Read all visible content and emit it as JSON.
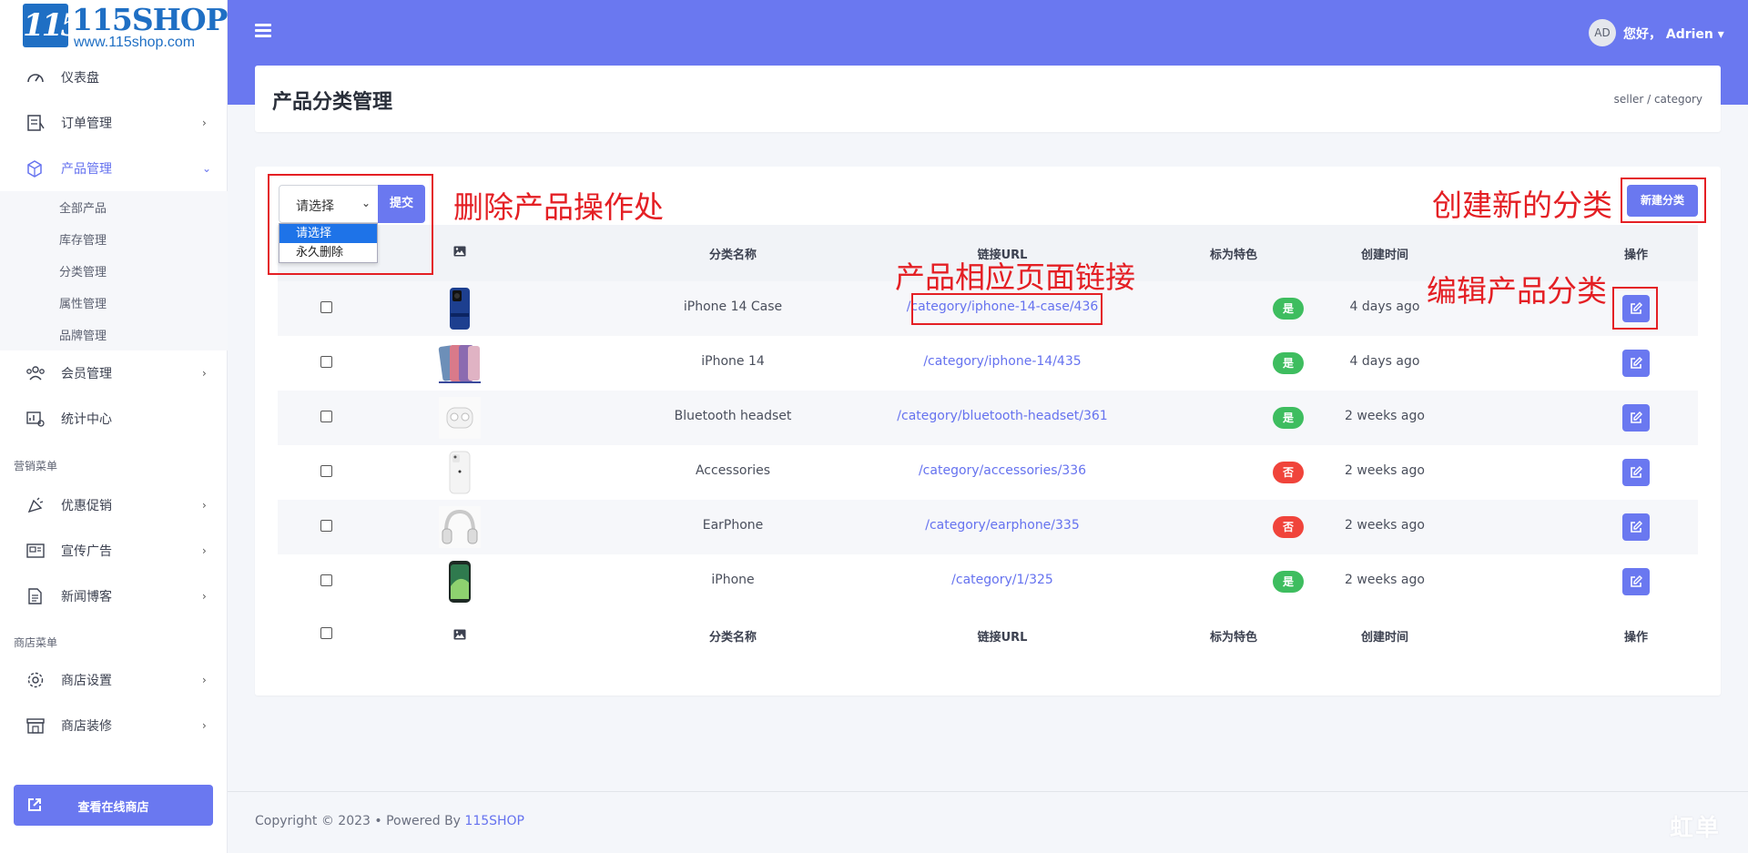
{
  "logo": {
    "mark": "115",
    "brand": "115SHOP",
    "site": "www.115shop.com"
  },
  "sidebar": {
    "items": [
      {
        "label": "仪表盘",
        "icon": "dashboard-icon"
      },
      {
        "label": "订单管理",
        "icon": "orders-icon"
      },
      {
        "label": "产品管理",
        "icon": "products-icon"
      },
      {
        "label": "会员管理",
        "icon": "members-icon"
      },
      {
        "label": "统计中心",
        "icon": "stats-icon"
      },
      {
        "label": "优惠促销",
        "icon": "promotion-icon"
      },
      {
        "label": "宣传广告",
        "icon": "ads-icon"
      },
      {
        "label": "新闻博客",
        "icon": "blog-icon"
      },
      {
        "label": "商店设置",
        "icon": "settings-icon"
      },
      {
        "label": "商店装修",
        "icon": "decor-icon"
      }
    ],
    "submenu": [
      "全部产品",
      "库存管理",
      "分类管理",
      "属性管理",
      "品牌管理"
    ],
    "section_marketing": "营销菜单",
    "section_shop": "商店菜单",
    "view_shop_label": "查看在线商店"
  },
  "header": {
    "avatar_initials": "AD",
    "greeting": "您好， Adrien ▾"
  },
  "page": {
    "title": "产品分类管理",
    "breadcrumb": "seller  /  category"
  },
  "toolbar": {
    "select_value": "请选择",
    "select_options": [
      "请选择",
      "永久删除"
    ],
    "submit_label": "提交",
    "new_category_label": "新建分类"
  },
  "table": {
    "columns": [
      "",
      "image-icon",
      "分类名称",
      "链接URL",
      "标为特色",
      "创建时间",
      "操作"
    ],
    "rows": [
      {
        "name": "iPhone 14 Case",
        "url": "/category/iphone-14-case/436",
        "featured": "是",
        "created": "4 days ago"
      },
      {
        "name": "iPhone 14",
        "url": "/category/iphone-14/435",
        "featured": "是",
        "created": "4 days ago"
      },
      {
        "name": "Bluetooth headset",
        "url": "/category/bluetooth-headset/361",
        "featured": "是",
        "created": "2 weeks ago"
      },
      {
        "name": "Accessories",
        "url": "/category/accessories/336",
        "featured": "否",
        "created": "2 weeks ago"
      },
      {
        "name": "EarPhone",
        "url": "/category/earphone/335",
        "featured": "否",
        "created": "2 weeks ago"
      },
      {
        "name": "iPhone",
        "url": "/category/1/325",
        "featured": "是",
        "created": "2 weeks ago"
      }
    ]
  },
  "annotations": {
    "delete_area": "删除产品操作处",
    "product_link": "产品相应页面链接",
    "create_category": "创建新的分类",
    "edit_category": "编辑产品分类"
  },
  "footer": {
    "copyright": "Copyright © 2023  •  Powered By ",
    "brand": "115SHOP"
  },
  "watermark": "虹单",
  "colors": {
    "accent": "#6a78f0",
    "yes": "#3ebd5f",
    "no": "#f0443b",
    "annotation": "#e41f24"
  }
}
